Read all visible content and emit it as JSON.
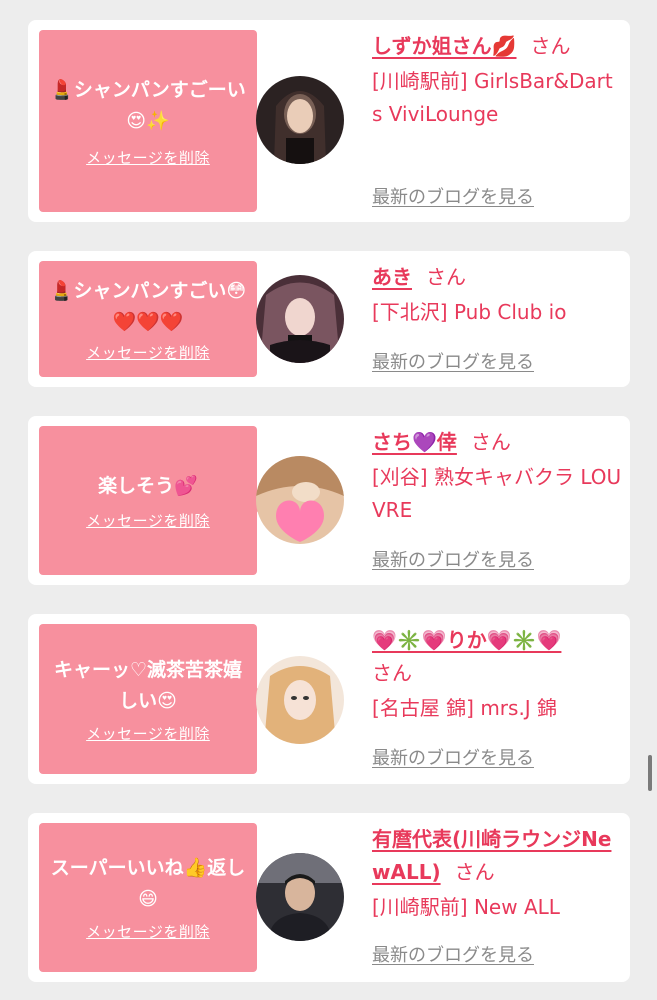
{
  "delete_label": "メッセージを削除",
  "blog_label": "最新のブログを見る",
  "san_label": "さん",
  "messages": [
    {
      "message": "💄シャンパンすごーい😍✨",
      "name": "しずか姐さん💋",
      "shop": "[川崎駅前] GirlsBar&Darts ViviLounge",
      "avatar_bg": "#3a2a2a"
    },
    {
      "message": "💄シャンパンすごい😳❤️❤️❤️",
      "name": "あき",
      "shop": "[下北沢] Pub Club io",
      "avatar_bg": "#5a3a44"
    },
    {
      "message": "楽しそう💕",
      "name": "さち💜倖",
      "shop": "[刈谷] 熟女キャバクラ LOUVRE",
      "avatar_bg": "#d9b49a"
    },
    {
      "message": "キャーッ♡滅茶苦茶嬉しい😍",
      "name": "💗✳️💗りか💗✳️💗",
      "shop": "[名古屋 錦] mrs.J 錦",
      "avatar_bg": "#e8c9a8"
    },
    {
      "message": "スーパーいいね👍返し😄",
      "name": "有麿代表(川崎ラウンジNewALL)",
      "shop": "[川崎駅前] New ALL",
      "avatar_bg": "#3a3a40"
    }
  ]
}
